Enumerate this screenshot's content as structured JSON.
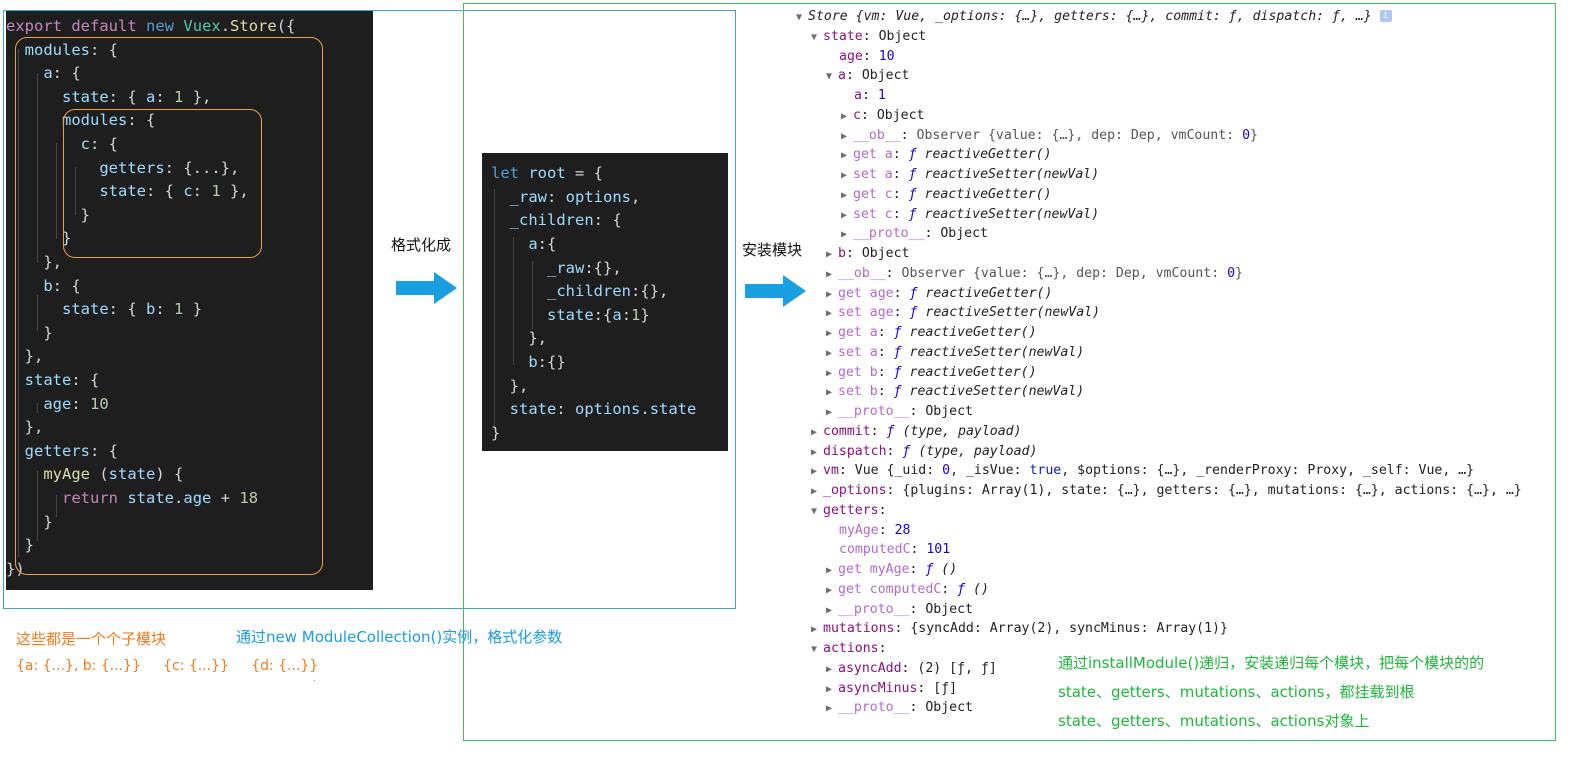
{
  "left_code": [
    "export default new Vuex.Store({",
    "  modules: {",
    "    a: {",
    "      state: { a: 1 },",
    "      modules: {",
    "        c: {",
    "          getters: {...},",
    "          state: { c: 1 },",
    "        }",
    "      }",
    "    },",
    "    b: {",
    "      state: { b: 1 }",
    "    }",
    "  },",
    "  state: {",
    "    age: 10",
    "  },",
    "  getters: {",
    "    myAge (state) {",
    "      return state.age + 18",
    "    }",
    "  }",
    "})"
  ],
  "middle_code": [
    "let root = {",
    "  _raw: options,",
    "  _children: {",
    "    a:{",
    "      _raw:{},",
    "      _children:{},",
    "      state:{a:1}",
    "    },",
    "    b:{}",
    "  },",
    "  state: options.state",
    "}"
  ],
  "labels": {
    "format_arrow": "格式化成",
    "install_arrow": "安装模块",
    "submodules_note": "这些都是一个个子模块",
    "submodules_examples": "{a: {...}, b: {...}}     {c: {...}}     {d: {...}}",
    "collection_note": "通过new ModuleCollection()实例，格式化参数",
    "install_note_1": "通过installModule()递归，安装递归每个模块，把每个模块的的",
    "install_note_2": "state、getters、mutations、actions，都挂载到根",
    "install_note_3": "state、getters、mutations、actions对象上",
    "dot": "."
  },
  "colors": {
    "orange": "#f07c1c",
    "blue": "#1a9ce0",
    "green": "#1fb83a",
    "frame_blue": "#3aa6d8",
    "frame_green": "#3cc25a"
  },
  "devtools": {
    "store_header": "Store {vm: Vue, _options: {…}, getters: {…}, commit: ƒ, dispatch: ƒ, …}",
    "info_badge": "i",
    "state_key": "state",
    "state_val": "Object",
    "age_key": "age",
    "age_val": "10",
    "a_key": "a",
    "a_val": "Object",
    "a_a_key": "a",
    "a_a_val": "1",
    "c_key": "c",
    "c_val": "Object",
    "ob_key": "__ob__",
    "ob_val": "Observer {value: {…}, dep: Dep, vmCount: ",
    "ob_zero": "0",
    "ob_end": "}",
    "get_a": "get a",
    "get_a_fn": "reactiveGetter()",
    "set_a": "set a",
    "set_a_fn": "reactiveSetter(newVal)",
    "get_c": "get c",
    "get_c_fn": "reactiveGetter()",
    "set_c": "set c",
    "set_c_fn": "reactiveSetter(newVal)",
    "proto_key": "__proto__",
    "proto_val": "Object",
    "b_key": "b",
    "b_val": "Object",
    "get_age": "get age",
    "get_age_fn": "reactiveGetter()",
    "set_age": "set age",
    "set_age_fn": "reactiveSetter(newVal)",
    "get_b": "get b",
    "get_b_fn": "reactiveGetter()",
    "set_b": "set b",
    "set_b_fn": "reactiveSetter(newVal)",
    "commit_key": "commit",
    "commit_val": "(type, payload)",
    "dispatch_key": "dispatch",
    "dispatch_val": "(type, payload)",
    "vm_key": "vm",
    "vm_val_1": "Vue {_uid: ",
    "vm_uid": "0",
    "vm_val_2": ", _isVue: ",
    "vm_true": "true",
    "vm_val_3": ", $options: {…}, _renderProxy: Proxy, _self: Vue, …}",
    "options_key": "_options",
    "options_val": "{plugins: Array(1), state: {…}, getters: {…}, mutations: {…}, actions: {…}, …}",
    "getters_key": "getters",
    "myage_key": "myAge",
    "myage_val": "28",
    "computedc_key": "computedC",
    "computedc_val": "101",
    "get_myage": "get myAge",
    "get_computedc": "get computedC",
    "fn_empty": "()",
    "mutations_key": "mutations",
    "mutations_val": "{syncAdd: Array(2), syncMinus: Array(1)}",
    "actions_key": "actions",
    "asyncadd_key": "asyncAdd",
    "asyncadd_val": "(2) [ƒ, ƒ]",
    "asyncminus_key": "asyncMinus",
    "asyncminus_val": "[ƒ]",
    "f": "ƒ"
  }
}
